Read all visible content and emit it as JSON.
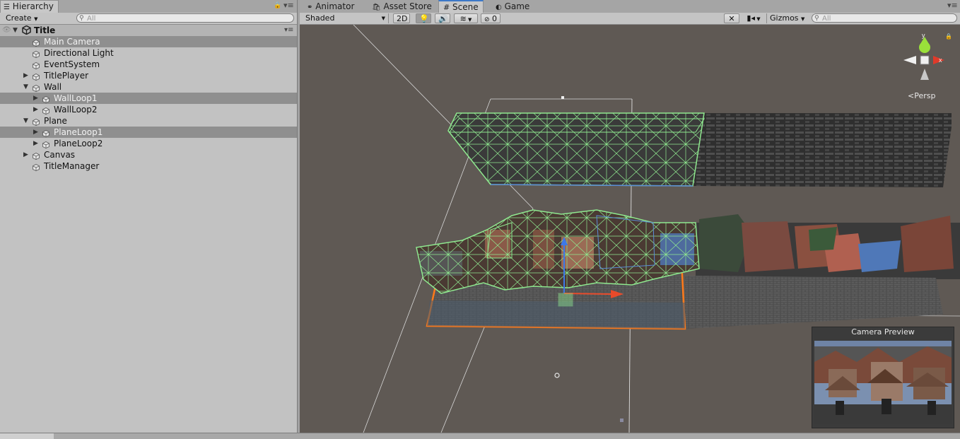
{
  "hierarchy": {
    "tab_label": "Hierarchy",
    "create_label": "Create",
    "search_placeholder": "All",
    "root_label": "Title",
    "items": [
      {
        "label": "Main Camera"
      },
      {
        "label": "Directional Light"
      },
      {
        "label": "EventSystem"
      },
      {
        "label": "TitlePlayer"
      },
      {
        "label": "Wall"
      },
      {
        "label": "WallLoop1"
      },
      {
        "label": "WallLoop2"
      },
      {
        "label": "Plane"
      },
      {
        "label": "PlaneLoop1"
      },
      {
        "label": "PlaneLoop2"
      },
      {
        "label": "Canvas"
      },
      {
        "label": "TitleManager"
      }
    ]
  },
  "tabs": [
    {
      "label": "Animator",
      "icon": "animator-icon"
    },
    {
      "label": "Asset Store",
      "icon": "store-icon"
    },
    {
      "label": "Scene",
      "icon": "grid-icon",
      "active": true
    },
    {
      "label": "Game",
      "icon": "pacman-icon"
    }
  ],
  "scene_toolbar": {
    "shading_mode": "Shaded",
    "mode_2d": "2D",
    "hidden_count": "0",
    "gizmos_label": "Gizmos",
    "search_placeholder": "All"
  },
  "scene_view": {
    "projection_label": "Persp",
    "axis_y": "y",
    "axis_x": "x",
    "camera_preview_title": "Camera Preview"
  },
  "colors": {
    "selection_green": "#8fe88f",
    "selection_orange": "#ff7a1a",
    "selection_blue": "#5a8cd6",
    "viewport_bg": "#5f5954",
    "active_tab_accent": "#3c78c8"
  }
}
